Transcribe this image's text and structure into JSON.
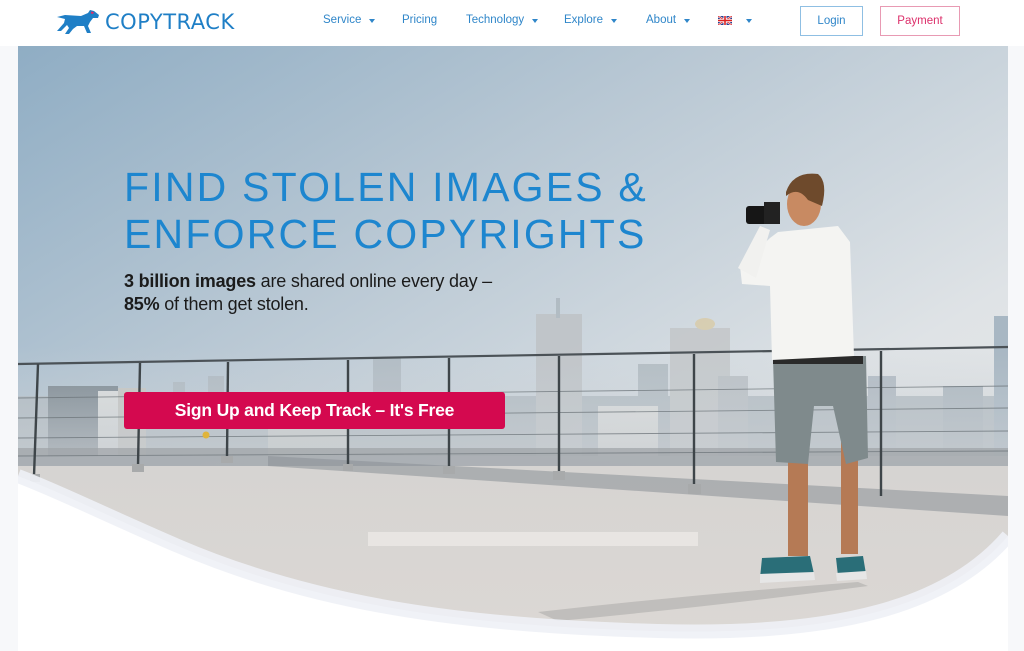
{
  "header": {
    "logo": {
      "text": "COPYTRACK",
      "icon": "dog-logo-icon"
    },
    "nav": [
      {
        "label": "Service",
        "has_dropdown": true
      },
      {
        "label": "Pricing",
        "has_dropdown": false
      },
      {
        "label": "Technology",
        "has_dropdown": true
      },
      {
        "label": "Explore",
        "has_dropdown": true
      },
      {
        "label": "About",
        "has_dropdown": true
      }
    ],
    "language": {
      "icon": "uk-flag-icon",
      "has_dropdown": true
    },
    "login_label": "Login",
    "payment_label": "Payment"
  },
  "hero": {
    "title_line1": "FIND STOLEN IMAGES &",
    "title_line2": "ENFORCE COPYRIGHTS",
    "subtitle": {
      "line1_bold": "3 billion images",
      "line1_rest": " are shared online every day –",
      "line2_bold": "85%",
      "line2_rest": " of them get stolen."
    },
    "cta_label": "Sign Up and Keep Track – It's Free",
    "background_image": "photographer-on-rooftop-city-skyline"
  },
  "colors": {
    "brand_blue": "#1d86cf",
    "nav_blue": "#2f86c9",
    "cta_red": "#d4094f",
    "payment_pink": "#dc2f6a"
  }
}
